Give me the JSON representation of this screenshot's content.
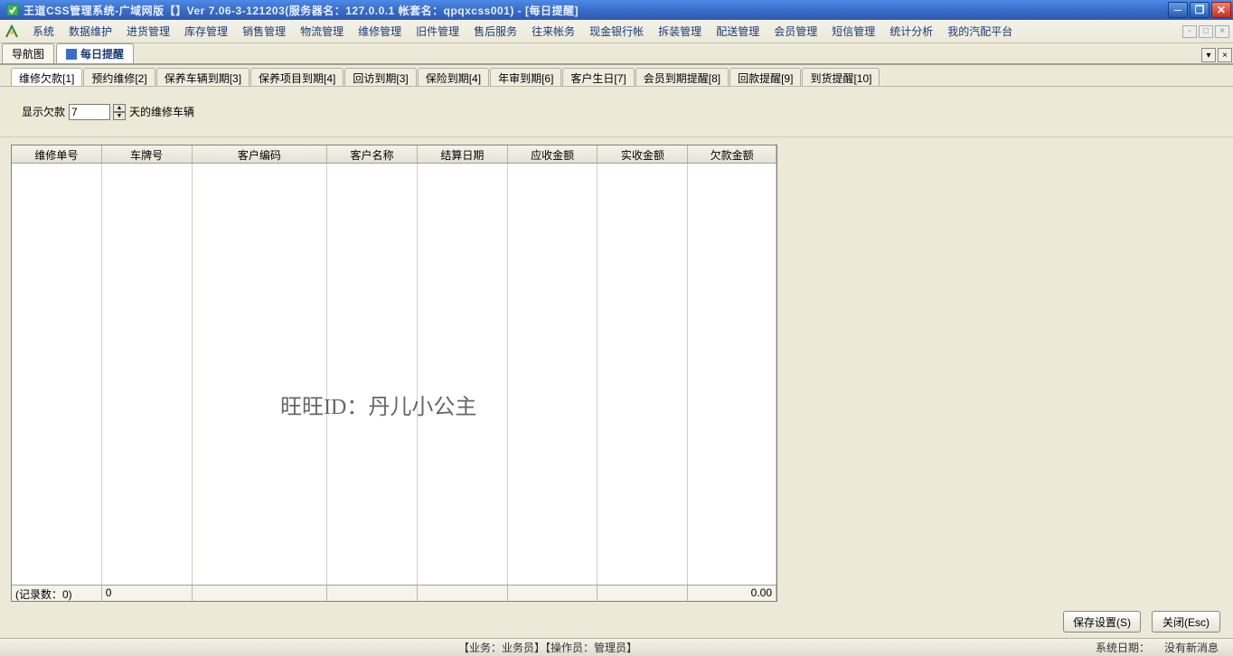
{
  "titlebar": {
    "text": "王道CSS管理系统-广域网版【】Ver 7.06-3-121203(服务器名：127.0.0.1 帐套名：qpqxcss001) - [每日提醒]"
  },
  "menubar": {
    "items": [
      "系统",
      "数据维护",
      "进货管理",
      "库存管理",
      "销售管理",
      "物流管理",
      "维修管理",
      "旧件管理",
      "售后服务",
      "往来帐务",
      "现金银行帐",
      "拆装管理",
      "配送管理",
      "会员管理",
      "短信管理",
      "统计分析",
      "我的汽配平台"
    ]
  },
  "page_tabs": {
    "items": [
      {
        "label": "导航图",
        "active": false
      },
      {
        "label": "每日提醒",
        "active": true
      }
    ]
  },
  "inner_tabs": {
    "items": [
      {
        "label": "维修欠款[1]",
        "active": true
      },
      {
        "label": "预约维修[2]",
        "active": false
      },
      {
        "label": "保养车辆到期[3]",
        "active": false
      },
      {
        "label": "保养项目到期[4]",
        "active": false
      },
      {
        "label": "回访到期[3]",
        "active": false
      },
      {
        "label": "保险到期[4]",
        "active": false
      },
      {
        "label": "年审到期[6]",
        "active": false
      },
      {
        "label": "客户生日[7]",
        "active": false
      },
      {
        "label": "会员到期提醒[8]",
        "active": false
      },
      {
        "label": "回款提醒[9]",
        "active": false
      },
      {
        "label": "到货提醒[10]",
        "active": false
      }
    ]
  },
  "filter": {
    "prefix": "显示欠款",
    "value": "7",
    "suffix": "天的维修车辆"
  },
  "table": {
    "headers": [
      "维修单号",
      "车牌号",
      "客户编码",
      "客户名称",
      "结算日期",
      "应收金额",
      "实收金额",
      "欠款金额"
    ],
    "footer_label": "(记录数：0)",
    "footer_c1": "0",
    "footer_total": "0.00"
  },
  "watermark": "旺旺ID：丹儿小公主",
  "buttons": {
    "save": "保存设置(S)",
    "close": "关闭(Esc)"
  },
  "statusbar": {
    "center": "【业务：业务员】【操作员：管理员】",
    "right1": "系统日期：",
    "right2": "没有新消息"
  }
}
